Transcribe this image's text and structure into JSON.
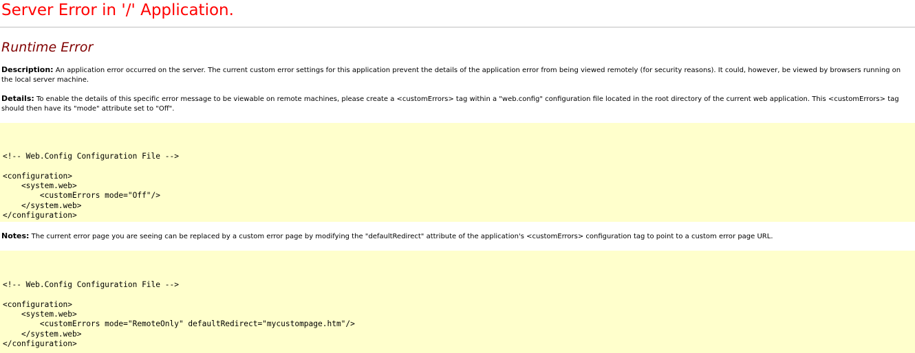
{
  "header": {
    "title": "Server Error in '/' Application."
  },
  "error": {
    "heading": "Runtime Error"
  },
  "description": {
    "label": "Description:",
    "text": "An application error occurred on the server. The current custom error settings for this application prevent the details of the application error from being viewed remotely (for security reasons). It could, however, be viewed by browsers running on the local server machine."
  },
  "details": {
    "label": "Details:",
    "text": "To enable the details of this specific error message to be viewable on remote machines, please create a <customErrors> tag within a \"web.config\" configuration file located in the root directory of the current web application. This <customErrors> tag should then have its \"mode\" attribute set to \"Off\"."
  },
  "code_sample_1": "\n<!-- Web.Config Configuration File -->\n\n<configuration>\n    <system.web>\n        <customErrors mode=\"Off\"/>\n    </system.web>\n</configuration>",
  "notes": {
    "label": "Notes:",
    "text": "The current error page you are seeing can be replaced by a custom error page by modifying the \"defaultRedirect\" attribute of the application's <customErrors> configuration tag to point to a custom error page URL."
  },
  "code_sample_2": "\n<!-- Web.Config Configuration File -->\n\n<configuration>\n    <system.web>\n        <customErrors mode=\"RemoteOnly\" defaultRedirect=\"mycustompage.htm\"/>\n    </system.web>\n</configuration>",
  "colors": {
    "title": "#ff0000",
    "heading": "#800000",
    "code_background": "#ffffcc",
    "divider": "#c0c0c0"
  }
}
